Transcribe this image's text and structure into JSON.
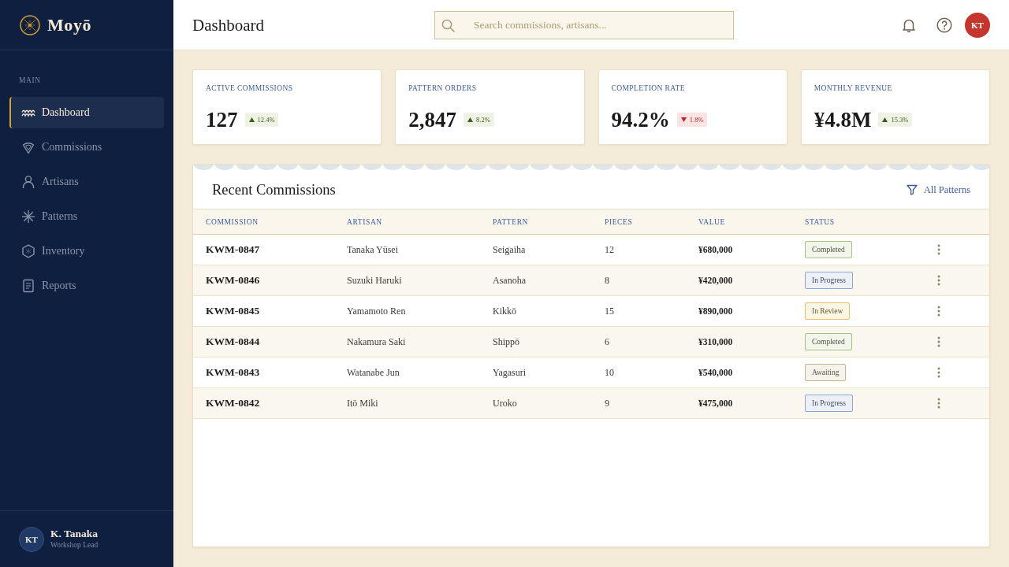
{
  "sidebar": {
    "brand": "Moyō",
    "section_label": "MAIN",
    "items": [
      {
        "label": "Dashboard",
        "selected": true
      },
      {
        "label": "Commissions",
        "selected": false
      },
      {
        "label": "Artisans",
        "selected": false
      },
      {
        "label": "Patterns",
        "selected": false
      },
      {
        "label": "Inventory",
        "selected": false
      },
      {
        "label": "Reports",
        "selected": false
      }
    ],
    "user": {
      "initials": "KT",
      "name": "K. Tanaka",
      "role": "Workshop Lead"
    }
  },
  "header": {
    "title": "Dashboard",
    "search": {
      "placeholder": "Search commissions, artisans..."
    },
    "avatar": {
      "initials": "KT"
    }
  },
  "stats": [
    {
      "label": "ACTIVE COMMISSIONS",
      "value": "127",
      "change": "12.4%",
      "negative": false
    },
    {
      "label": "PATTERN ORDERS",
      "value": "2,847",
      "change": "8.2%",
      "negative": false
    },
    {
      "label": "COMPLETION RATE",
      "value": "94.2%",
      "change": "1.8%",
      "negative": true
    },
    {
      "label": "MONTHLY REVENUE",
      "value": "¥4.8M",
      "change": "15.3%",
      "negative": false
    }
  ],
  "table": {
    "title": "Recent Commissions",
    "filter": "All Patterns",
    "columns": [
      "COMMISSION",
      "ARTISAN",
      "PATTERN",
      "PIECES",
      "VALUE",
      "STATUS"
    ],
    "rows": [
      {
        "commission": "KWM-0847",
        "artisan": "Tanaka Yūsei",
        "pattern": "Seigaiha",
        "pieces": "12",
        "value": "¥680,000",
        "status": {
          "label": "Completed",
          "color": "#a8c080"
        }
      },
      {
        "commission": "KWM-0846",
        "artisan": "Suzuki Haruki",
        "pattern": "Asanoha",
        "pieces": "8",
        "value": "¥420,000",
        "status": {
          "label": "In Progress",
          "color": "#8ea6cf"
        }
      },
      {
        "commission": "KWM-0845",
        "artisan": "Yamamoto Ren",
        "pattern": "Kikkō",
        "pieces": "15",
        "value": "¥890,000",
        "status": {
          "label": "In Review",
          "color": "#e8c060"
        }
      },
      {
        "commission": "KWM-0844",
        "artisan": "Nakamura Saki",
        "pattern": "Shippō",
        "pieces": "6",
        "value": "¥310,000",
        "status": {
          "label": "Completed",
          "color": "#a8c080"
        }
      },
      {
        "commission": "KWM-0843",
        "artisan": "Watanabe Jun",
        "pattern": "Yagasuri",
        "pieces": "10",
        "value": "¥540,000",
        "status": {
          "label": "Awaiting",
          "color": "#c8b48c"
        }
      },
      {
        "commission": "KWM-0842",
        "artisan": "Itō Miki",
        "pattern": "Uroko",
        "pieces": "9",
        "value": "¥475,000",
        "status": {
          "label": "In Progress",
          "color": "#8ea6cf"
        }
      }
    ]
  }
}
